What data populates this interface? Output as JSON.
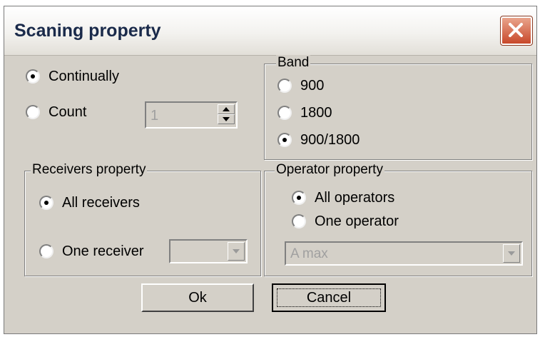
{
  "dialog": {
    "title": "Scaning property",
    "close_icon": "close-icon",
    "accent": "#c8482a"
  },
  "mode": {
    "continually_label": "Continually",
    "count_label": "Count",
    "selected": "Continually",
    "count_value": "1"
  },
  "band": {
    "legend": "Band",
    "options": [
      "900",
      "1800",
      "900/1800"
    ],
    "selected": "900/1800"
  },
  "receivers": {
    "legend": "Receivers property",
    "all_label": "All receivers",
    "one_label": "One receiver",
    "selected": "All receivers",
    "combo_value": ""
  },
  "operator": {
    "legend": "Operator property",
    "all_label": "All operators",
    "one_label": "One operator",
    "selected": "All operators",
    "combo_value": "A max"
  },
  "buttons": {
    "ok_label": "Ok",
    "cancel_label": "Cancel"
  }
}
